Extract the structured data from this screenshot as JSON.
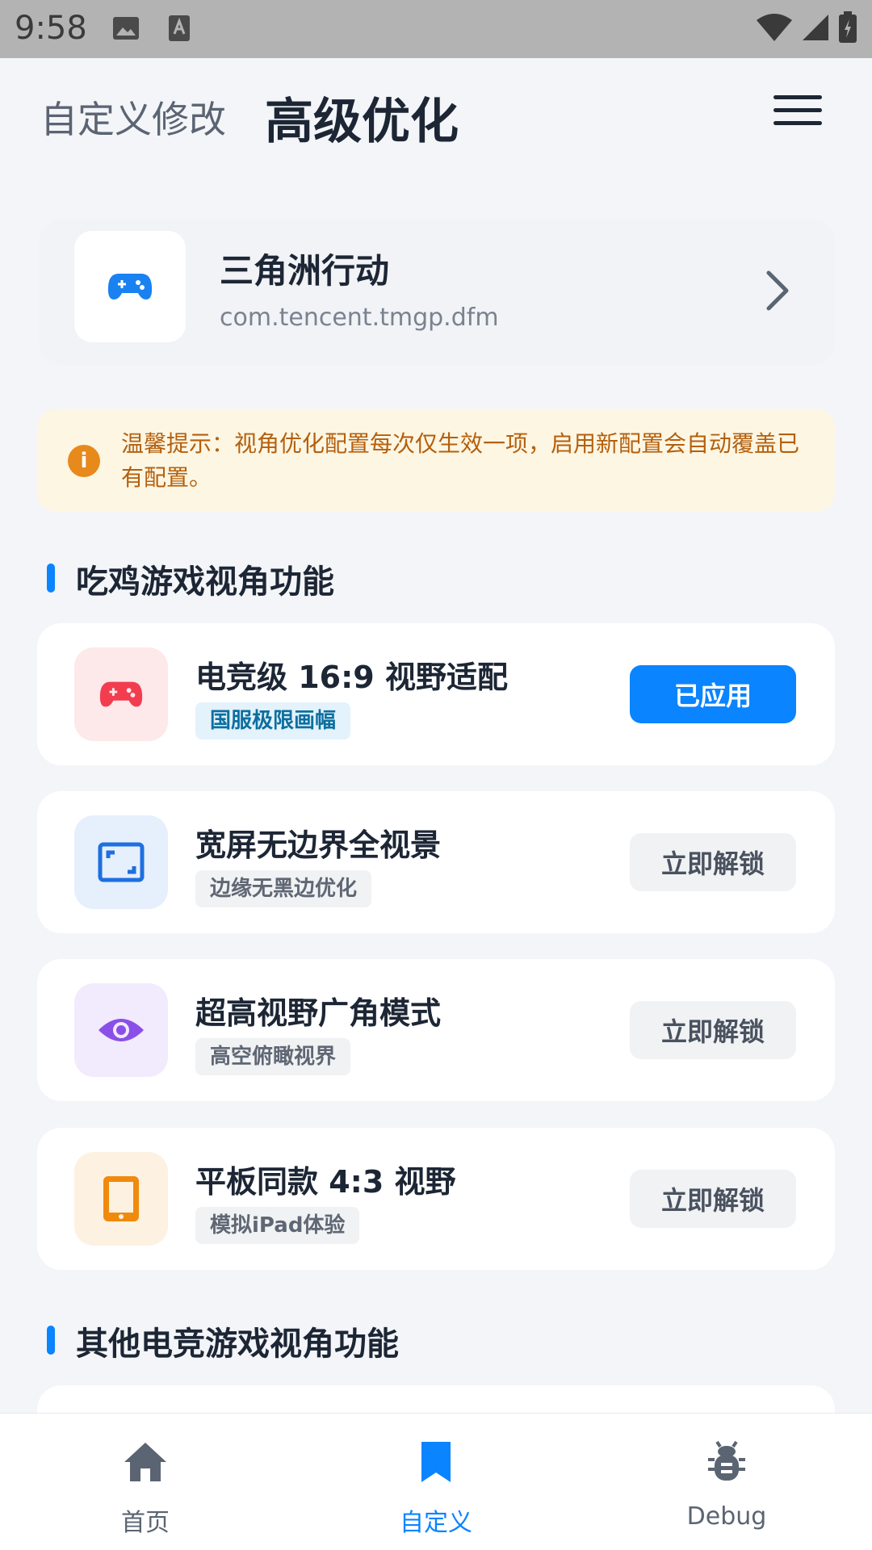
{
  "status_bar": {
    "time": "9:58"
  },
  "header": {
    "tab_custom": "自定义修改",
    "tab_advanced": "高级优化"
  },
  "app": {
    "name": "三角洲行动",
    "package": "com.tencent.tmgp.dfm",
    "icon": "gamepad-icon"
  },
  "notice": {
    "text": "温馨提示：视角优化配置每次仅生效一项，启用新配置会自动覆盖已有配置。",
    "icon": "info-icon"
  },
  "sections": [
    {
      "title": "吃鸡游戏视角功能"
    },
    {
      "title": "其他电竞游戏视角功能"
    }
  ],
  "features": [
    {
      "title": "电竞级 16:9 视野适配",
      "tag": "国服极限画幅",
      "button": "已应用",
      "state": "applied",
      "icon": "gamepad-icon",
      "accent": "#f23d4f"
    },
    {
      "title": "宽屏无边界全视景",
      "tag": "边缘无黑边优化",
      "button": "立即解锁",
      "state": "locked",
      "icon": "aspect-ratio-icon",
      "accent": "#1e6fe0"
    },
    {
      "title": "超高视野广角模式",
      "tag": "高空俯瞰视界",
      "button": "立即解锁",
      "state": "locked",
      "icon": "eye-icon",
      "accent": "#8a4fe8"
    },
    {
      "title": "平板同款 4:3 视野",
      "tag": "模拟iPad体验",
      "button": "立即解锁",
      "state": "locked",
      "icon": "tablet-icon",
      "accent": "#f08a0c"
    }
  ],
  "bottom_nav": [
    {
      "label": "首页",
      "icon": "home-icon",
      "active": false
    },
    {
      "label": "自定义",
      "icon": "bookmark-icon",
      "active": true
    },
    {
      "label": "Debug",
      "icon": "bug-icon",
      "active": false
    }
  ],
  "colors": {
    "accent": "#0a84ff",
    "nav_active": "#0a84ff",
    "nav_inactive": "#5b6472",
    "notice_text": "#b4600e"
  }
}
